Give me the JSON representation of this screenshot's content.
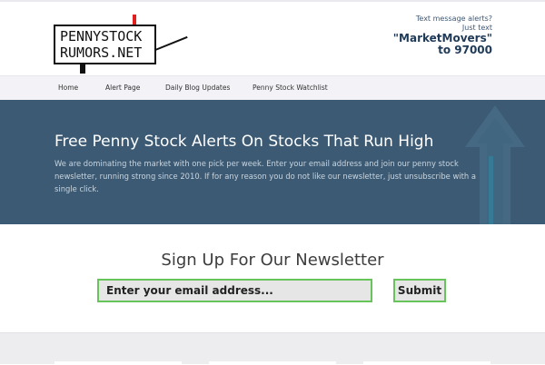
{
  "logo": {
    "line1": "PENNYSTOCK",
    "line2": "RUMORS.NET",
    "colors": {
      "flag": "#e02020",
      "ink": "#111111"
    }
  },
  "sms_promo": {
    "intro": "Text message alerts? Just text",
    "keyword": "\"MarketMovers\"",
    "shortcode": "to 97000"
  },
  "nav": {
    "items": [
      {
        "label": "Home"
      },
      {
        "label": "Alert Page"
      },
      {
        "label": "Daily Blog Updates"
      },
      {
        "label": "Penny Stock Watchlist"
      }
    ]
  },
  "hero": {
    "title": "Free Penny Stock Alerts On Stocks That Run High",
    "text": "We are dominating the market with one pick per week. Enter your email address and join our penny stock newsletter, running strong since 2010. If for any reason you do not like our newsletter, just unsubscribe with a single click.",
    "background_color": "#3c5a73",
    "decoration_icon": "up-arrow-icon"
  },
  "signup": {
    "title": "Sign Up For Our Newsletter",
    "email_placeholder": "Enter your email address...",
    "email_value": "",
    "submit_label": "Submit",
    "accent_color": "#66c45a"
  }
}
